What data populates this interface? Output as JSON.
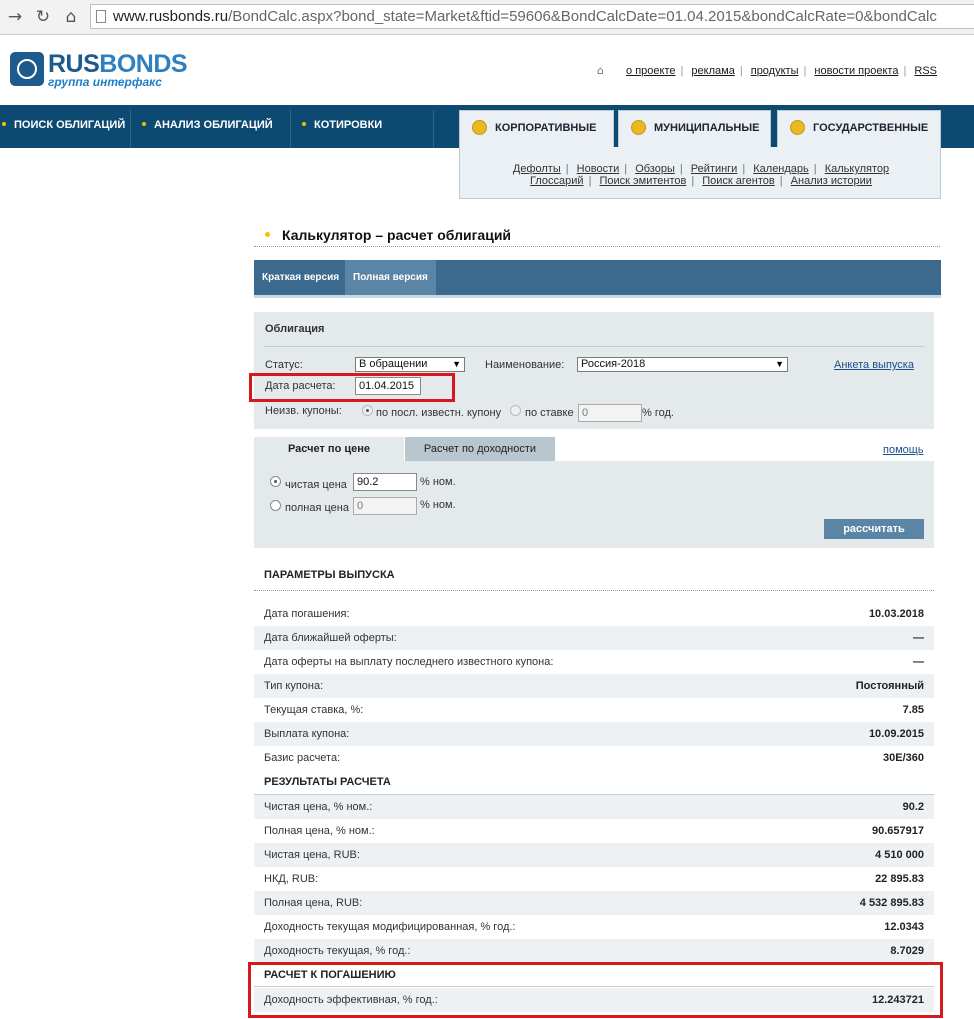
{
  "browser": {
    "url_host": "www.rusbonds.ru",
    "url_rest": "/BondCalc.aspx?bond_state=Market&ftid=59606&BondCalcDate=01.04.2015&bondCalcRate=0&bondCalc"
  },
  "logo": {
    "name_a": "RUS",
    "name_b": "BONDS",
    "subtitle": "группа интерфакс"
  },
  "top_links": [
    "о проекте",
    "реклама",
    "продукты",
    "новости проекта",
    "RSS"
  ],
  "nav": [
    "ПОИСК ОБЛИГАЦИЙ",
    "АНАЛИЗ ОБЛИГАЦИЙ",
    "КОТИРОВКИ"
  ],
  "market_tabs": [
    "КОРПОРАТИВНЫЕ",
    "МУНИЦИПАЛЬНЫЕ",
    "ГОСУДАРСТВЕННЫЕ"
  ],
  "sub_links_1": [
    "Дефолты",
    "Новости",
    "Обзоры",
    "Рейтинги",
    "Календарь",
    "Калькулятор"
  ],
  "sub_links_2": [
    "Глоссарий",
    "Поиск эмитентов",
    "Поиск агентов",
    "Анализ истории"
  ],
  "page_title": "Калькулятор – расчет облигаций",
  "version_tabs": [
    "Краткая версия",
    "Полная версия"
  ],
  "form": {
    "heading": "Облигация",
    "status_label": "Статус:",
    "status_value": "В обращении",
    "name_label": "Наименование:",
    "name_value": "Россия-2018",
    "issue_link": "Анкета выпуска",
    "date_label": "Дата расчета:",
    "date_value": "01.04.2015",
    "coupons_label": "Неизв. купоны:",
    "coupon_opt1": "по посл. известн. купону",
    "coupon_opt2": "по ставке",
    "rate_value": "0",
    "rate_unit": "% год."
  },
  "calc_tabs": [
    "Расчет по цене",
    "Расчет по доходности"
  ],
  "help_link": "помощь",
  "calc": {
    "clean_label": "чистая цена",
    "clean_value": "90.2",
    "clean_unit": "% ном.",
    "full_label": "полная цена",
    "full_value": "0",
    "full_unit": "% ном.",
    "button": "рассчитать"
  },
  "params": {
    "title": "ПАРАМЕТРЫ ВЫПУСКА",
    "rows": [
      {
        "label": "Дата погашения:",
        "value": "10.03.2018"
      },
      {
        "label": "Дата ближайшей оферты:",
        "value": "—"
      },
      {
        "label": "Дата оферты на выплату последнего известного купона:",
        "value": "—"
      },
      {
        "label": "Тип купона:",
        "value": "Постоянный"
      },
      {
        "label": "Текущая ставка, %:",
        "value": "7.85"
      },
      {
        "label": "Выплата купона:",
        "value": "10.09.2015"
      },
      {
        "label": "Базис расчета:",
        "value": "30E/360"
      }
    ]
  },
  "results": {
    "title": "РЕЗУЛЬТАТЫ РАСЧЕТА",
    "rows": [
      {
        "label": "Чистая цена, % ном.:",
        "value": "90.2"
      },
      {
        "label": "Полная цена, % ном.:",
        "value": "90.657917"
      },
      {
        "label": "Чистая цена, RUB:",
        "value": "4 510 000"
      },
      {
        "label": "НКД, RUB:",
        "value": "22 895.83"
      },
      {
        "label": "Полная цена, RUB:",
        "value": "4 532 895.83"
      },
      {
        "label": "Доходность текущая модифицированная, % год.:",
        "value": "12.0343"
      },
      {
        "label": "Доходность текущая, % год.:",
        "value": "8.7029"
      }
    ]
  },
  "maturity": {
    "title": "РАСЧЕТ К ПОГАШЕНИЮ",
    "rows": [
      {
        "label": "Доходность эффективная, % год.:",
        "value": "12.243721"
      }
    ]
  },
  "colors": {
    "nav_bg": "#0c4a72",
    "accent": "#f0c400",
    "highlight": "#d6191d",
    "button": "#5b85a6"
  }
}
